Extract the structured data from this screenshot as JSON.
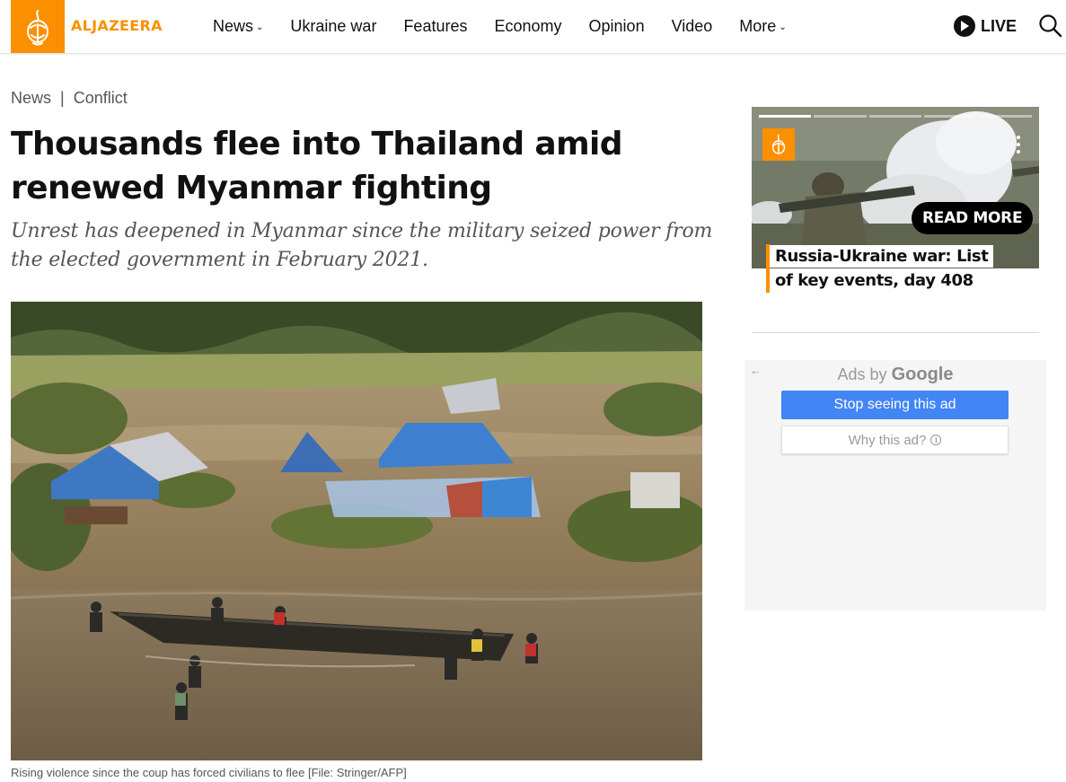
{
  "header": {
    "logo_text": "ALJAZEERA",
    "brand_color": "#fa9000",
    "nav": [
      {
        "label": "News",
        "dropdown": true
      },
      {
        "label": "Ukraine war",
        "dropdown": false
      },
      {
        "label": "Features",
        "dropdown": false
      },
      {
        "label": "Economy",
        "dropdown": false
      },
      {
        "label": "Opinion",
        "dropdown": false
      },
      {
        "label": "Video",
        "dropdown": false
      },
      {
        "label": "More",
        "dropdown": true
      }
    ],
    "live_label": "LIVE",
    "search_icon": "search-icon"
  },
  "article": {
    "breadcrumb": [
      "News",
      "Conflict"
    ],
    "headline": "Thousands flee into Thailand amid renewed Myanmar fighting",
    "standfirst": "Unrest has deepened in Myanmar since the military seized power from the elected government in February 2021.",
    "caption": "Rising violence since the coup has forced civilians to flee [File: Stringer/AFP]"
  },
  "sidebar": {
    "video_card": {
      "read_more": "READ MORE",
      "title": "Russia-Ukraine war: List of key events, day 408",
      "progress_segments": 5,
      "active_segment": 1
    },
    "ad": {
      "back_icon": "back-arrow-icon",
      "ads_by": "Ads by",
      "google": "Google",
      "stop_label": "Stop seeing this ad",
      "why_label": "Why this ad?"
    }
  }
}
